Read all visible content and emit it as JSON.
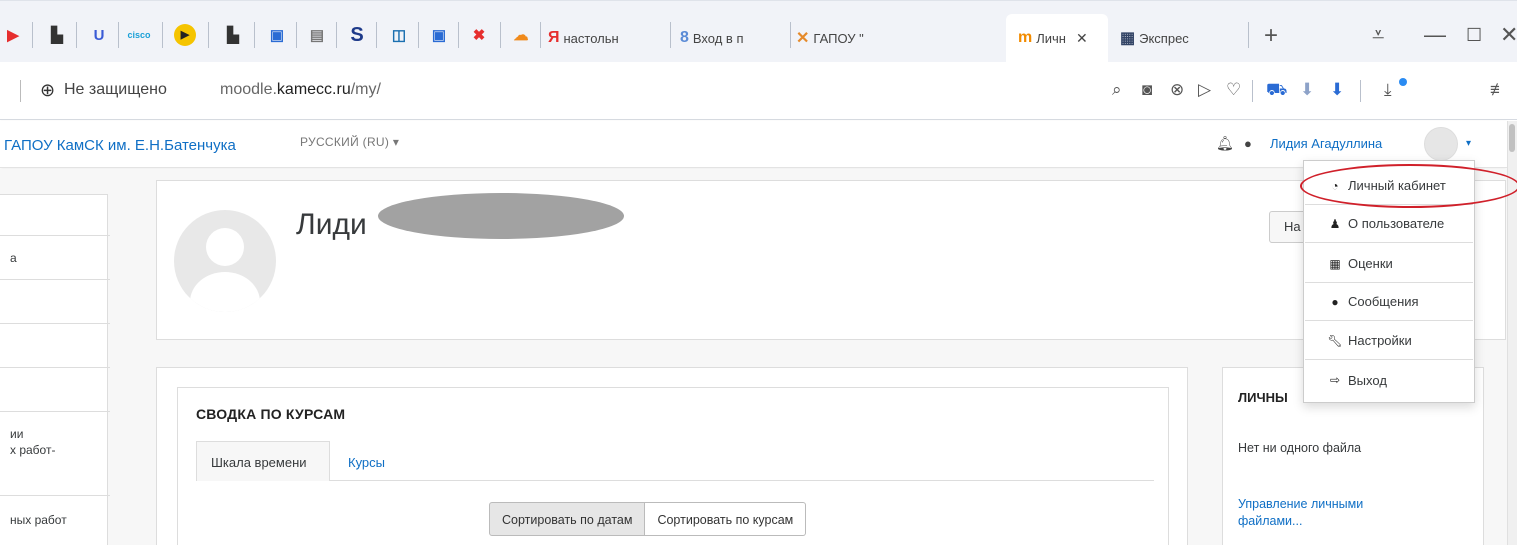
{
  "browser": {
    "tabs": [
      {
        "icon": "Я",
        "label": "настольн",
        "icon_color": "#e62e2e"
      },
      {
        "icon": "8",
        "label": "Вход в п",
        "icon_color": "#5a8bd6"
      },
      {
        "icon": "✕",
        "label": "ГАПОУ \"",
        "icon_color": "#e58a2a"
      },
      {
        "icon": "m",
        "label": "Личн",
        "icon_color": "#f28b00"
      },
      {
        "icon": "▦",
        "label": "Экспрес",
        "icon_color": "#334466"
      }
    ],
    "active_tab_close": "✕",
    "new_tab": "+",
    "window_controls": {
      "menu": "⩡",
      "minimize": "—",
      "maximize": "☐",
      "close": "✕"
    },
    "security_label": "Не защищено",
    "url_prefix": "moodle.",
    "url_domain": "kamecc.ru",
    "url_path": "/my/"
  },
  "site": {
    "name": "ГАПОУ КамСК им. Е.Н.Батенчука",
    "language": "РУССКИЙ (RU) ▾",
    "user_name": "Лидия Агадуллина",
    "caret": "▾"
  },
  "leftnav": {
    "items": [
      {
        "label": ""
      },
      {
        "label": "а"
      },
      {
        "label": ""
      },
      {
        "label": ""
      },
      {
        "label": "ии\nх работ-"
      },
      {
        "label": "ных работ"
      }
    ]
  },
  "profile": {
    "fullname_visible": "Лиди",
    "customise_label": "На"
  },
  "course_overview": {
    "title": "СВОДКА ПО КУРСАМ",
    "tabs": [
      "Шкала времени",
      "Курсы"
    ],
    "sort_buttons": [
      "Сортировать по датам",
      "Сортировать по курсам"
    ]
  },
  "private_files": {
    "title": "ЛИЧНЫ",
    "empty": "Нет ни одного файла",
    "manage_link": "Управление личными файлами..."
  },
  "user_menu": {
    "items": [
      {
        "label": "Личный кабинет",
        "icon": "dashboard-icon"
      },
      {
        "label": "О пользователе",
        "icon": "user-icon"
      },
      {
        "label": "Оценки",
        "icon": "table-icon"
      },
      {
        "label": "Сообщения",
        "icon": "comment-icon"
      },
      {
        "label": "Настройки",
        "icon": "wrench-icon"
      },
      {
        "label": "Выход",
        "icon": "sign-out-icon"
      }
    ],
    "highlight_color": "#d0202a"
  },
  "colors": {
    "link": "#0f6fc5",
    "bg": "#f7f7f7"
  }
}
